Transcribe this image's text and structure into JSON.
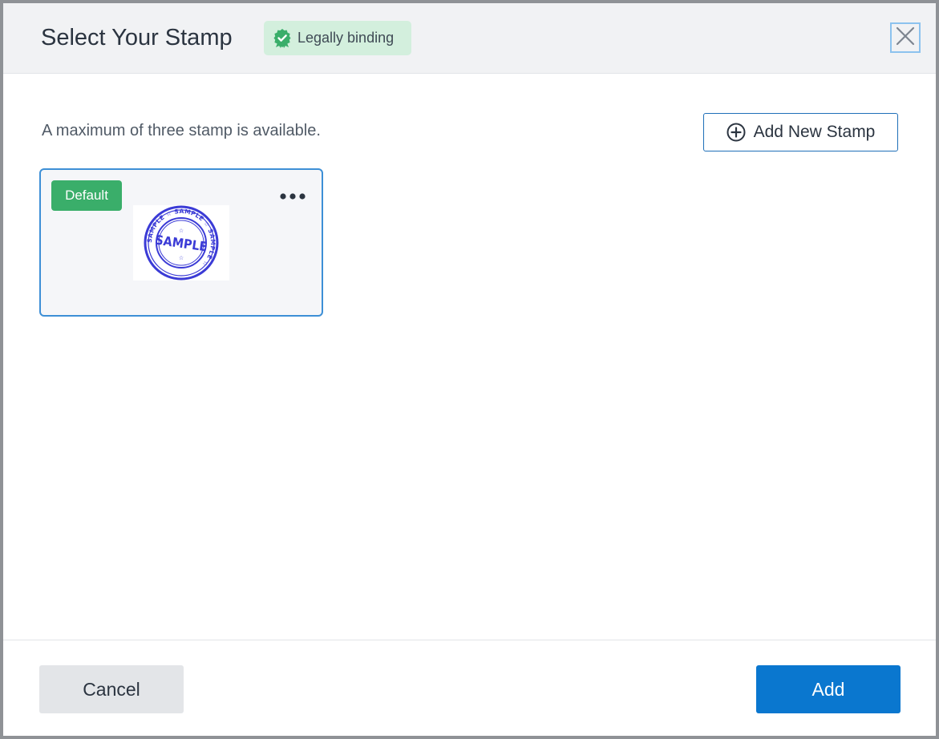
{
  "dialog": {
    "title": "Select Your Stamp",
    "badge": {
      "label": "Legally binding",
      "icon": "verified-badge-icon",
      "color": "#3aae6a"
    },
    "close_icon": "close-icon"
  },
  "content": {
    "helper_text": "A maximum of three stamp is available.",
    "add_new_stamp_label": "Add New Stamp",
    "add_new_stamp_icon": "plus-circle-icon",
    "stamps": [
      {
        "tag": "Default",
        "stamp_text": "SAMPLE",
        "ring_text": "SAMPLE ☆ SAMPLE ☆ SAMPLE ☆",
        "selected": true,
        "menu_icon": "more-horizontal-icon"
      }
    ]
  },
  "footer": {
    "cancel_label": "Cancel",
    "add_label": "Add"
  },
  "colors": {
    "primary": "#0a77cf",
    "success": "#3aae6a",
    "stamp_ink": "#3b3bd6"
  }
}
